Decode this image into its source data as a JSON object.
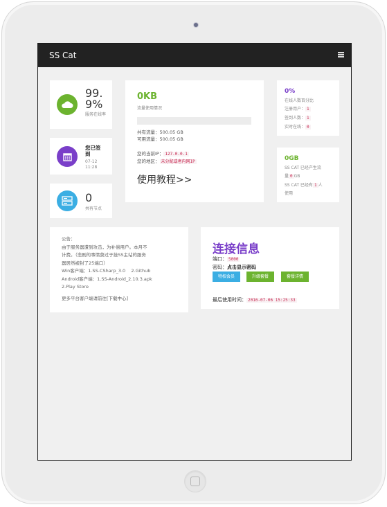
{
  "app": {
    "brand": "SS Cat"
  },
  "stats": {
    "uptime": {
      "value": "99.\n9%",
      "label": "服务在线率"
    },
    "checkin": {
      "title": "您已签到",
      "date": "07-12",
      "time": "11:28"
    },
    "nodes": {
      "value": "0",
      "label": "共有节点"
    }
  },
  "traffic": {
    "used": "0KB",
    "label": "流量使用情况",
    "progress": 0,
    "total_line": "共有流量：500.05 GB",
    "available_line": "可用流量：500.05 GB",
    "ip_label": "您的当前IP：",
    "ip_value": "127.0.0.1",
    "region_label": "您的地区：",
    "region_value": "未分配或者内网IP",
    "tutorial": "使用教程>>"
  },
  "online": {
    "percent": "0%",
    "desc": "在线人数百分比",
    "registered_label": "注册用户：",
    "registered_value": "1",
    "checked_label": "签到人数：",
    "checked_value": "1",
    "realtime_label": "实时在线：",
    "realtime_value": "0"
  },
  "generated": {
    "value": "0GB",
    "line1": "SS CAT 已经产生流",
    "line2_pre": "量",
    "line2_code": "0",
    "line2_post": "GB",
    "line3_pre": "SS CAT 已经有",
    "line3_code": "1",
    "line3_post": "人",
    "line4": "使用"
  },
  "notice": {
    "title": "公告：",
    "l1": "由于服务器遭到攻击，为补偿用户。本月不",
    "l2": "计费。（悲剧的事情莫过于挂SS主站的服务",
    "l3": "器居然被封了25端口）",
    "l4": "Win客户端：1.SS-CSharp_3.0    2.Github",
    "l5": "Android客户端：1.SS-Android_2.10.3.apk",
    "l6": "2.Play Store",
    "l7": "更多平台客户端请前往",
    "l7_link": "[下载中心]"
  },
  "connection": {
    "title": "连接信息",
    "port_label": "端口：",
    "port_value": "5000",
    "pwd_label": "密码：",
    "pwd_value": "点击显示密码",
    "btn_vip": "特权会员",
    "btn_upgrade": "升级套餐",
    "btn_detail": "套餐详情",
    "last_used_label": "最后使用时间：",
    "last_used_value": "2016-07-06 15:25:33"
  },
  "colors": {
    "green": "#6cb32f",
    "purple": "#7a3fc9",
    "blue": "#3baee3",
    "navbar": "#222222"
  }
}
